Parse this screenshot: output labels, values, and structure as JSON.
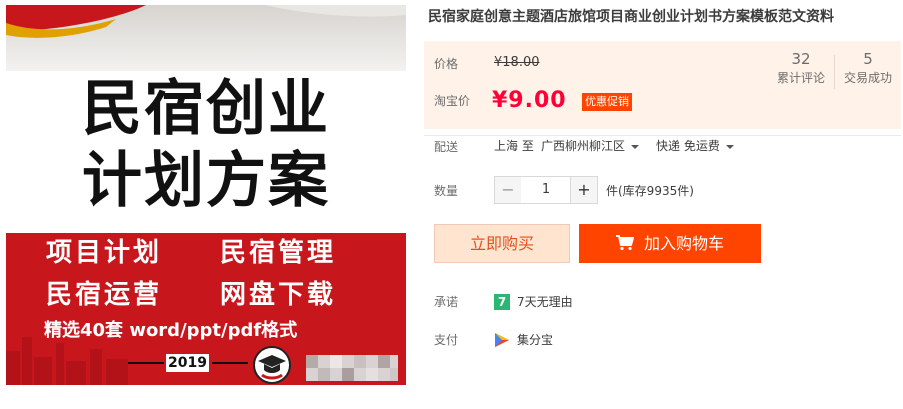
{
  "product_image": {
    "title_line1": "民宿创业",
    "title_line2": "计划方案",
    "feature1": "项目计划",
    "feature2": "民宿管理",
    "feature3": "民宿运营",
    "feature4": "网盘下载",
    "formats": "精选40套 word/ppt/pdf格式",
    "year": "2019"
  },
  "product": {
    "title": "民宿家庭创意主题酒店旅馆项目商业创业计划书方案模板范文资料"
  },
  "price": {
    "label": "价格",
    "original": "¥18.00",
    "taobao_label": "淘宝价",
    "current": "¥9.00",
    "promo": "优惠促销"
  },
  "stats": {
    "reviews_count": "32",
    "reviews_label": "累计评论",
    "sales_count": "5",
    "sales_label": "交易成功"
  },
  "shipping": {
    "label": "配送",
    "from": "上海 至",
    "to": "广西柳州柳江区",
    "method": "快递 免运费"
  },
  "quantity": {
    "label": "数量",
    "minus": "−",
    "value": "1",
    "plus": "+",
    "stock": "件(库存9935件)"
  },
  "actions": {
    "buy_now": "立即购买",
    "add_to_cart": "加入购物车"
  },
  "services": {
    "promise_label": "承诺",
    "promise_badge": "7",
    "promise_text": "7天无理由",
    "payment_label": "支付",
    "payment_text": "集分宝"
  },
  "colors": {
    "accent": "#ff4400",
    "price_red": "#ff0036",
    "price_bg": "#fff2e8",
    "promise_green": "#2bb673"
  }
}
